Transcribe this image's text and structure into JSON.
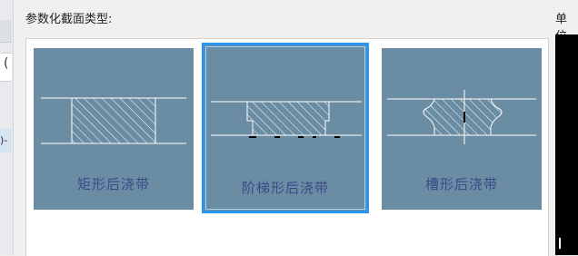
{
  "section_label": "参数化截面类型:",
  "units_label": "单位",
  "left_strip": {
    "glyph1": "(",
    "glyph2": ")-"
  },
  "tiles": [
    {
      "label": "矩形后浇带",
      "selected": false
    },
    {
      "label": "阶梯形后浇带",
      "selected": true
    },
    {
      "label": "槽形后浇带",
      "selected": false
    }
  ],
  "colors": {
    "tile_bg": "#6b8da3",
    "label_text": "#3a4a8a",
    "selection_border": "#2b96f0",
    "line": "#ffffff"
  }
}
